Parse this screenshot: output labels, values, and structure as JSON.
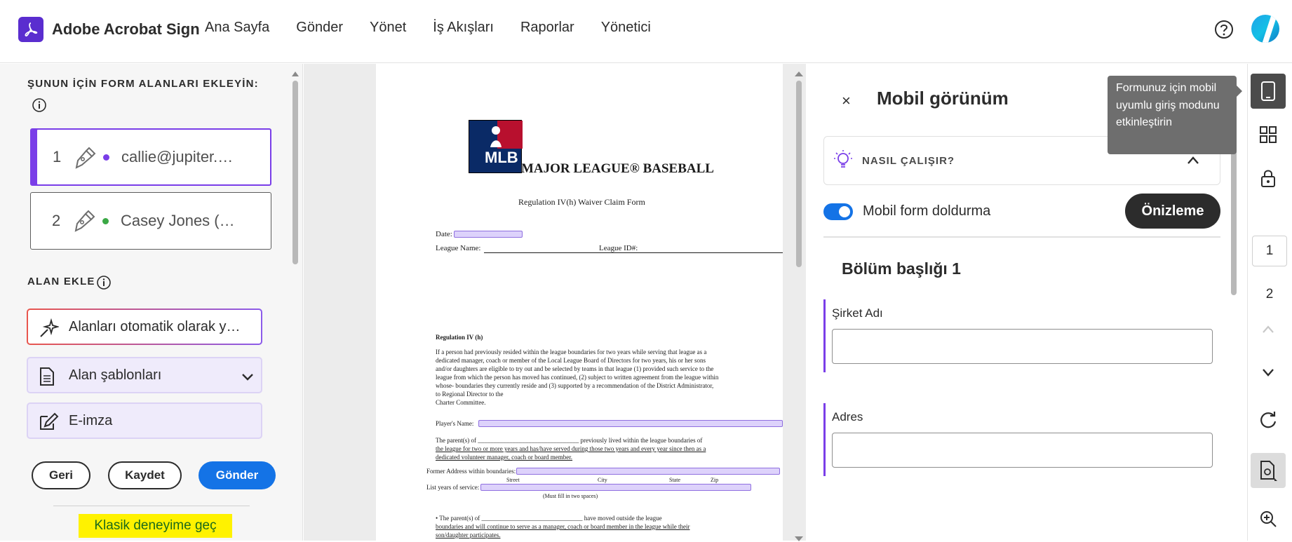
{
  "app": {
    "brand": "Adobe Acrobat Sign"
  },
  "nav": [
    "Ana Sayfa",
    "Gönder",
    "Yönet",
    "İş Akışları",
    "Raporlar",
    "Yönetici"
  ],
  "left": {
    "title": "ŞUNUN İÇİN FORM ALANLARI EKLEYİN:",
    "recipients": [
      {
        "num": "1",
        "email": "callie@jupiter.…",
        "color": "#7a3ee8"
      },
      {
        "num": "2",
        "email": "Casey Jones (…",
        "color": "#3aa845"
      }
    ],
    "add_title": "ALAN EKLE",
    "auto_label": "Alanları otomatik olarak y…",
    "templates_label": "Alan şablonları",
    "esign_label": "E-imza",
    "back_label": "Geri",
    "save_label": "Kaydet",
    "send_label": "Gönder",
    "classic_label": "Klasik deneyime geç"
  },
  "doc": {
    "logo_text": "MLB",
    "title": "MAJOR LEAGUE® BASEBALL",
    "form_title": "Regulation IV(h) Waiver Claim Form",
    "date_label": "Date:",
    "league_name_label": "League Name:",
    "league_id_label": "League ID#:",
    "reg_heading": "Regulation IV (h)",
    "paragraph": [
      "If a person had previously resided within the league boundaries for two years while serving that league as a",
      "dedicated manager, coach or member of the Local League Board of Directors for two years, his or her sons",
      "and/or daughters are eligible to try out and be selected by teams in that league (1) provided such service to the",
      "league from which the person has moved has continued, (2) subject to written agreement from the league within",
      "whose- boundaries they currently reside and (3) supported by a recommendation of the District Administrator,",
      "to Regional Director to the",
      "Charter Committee."
    ],
    "player_name_label": "Player's Name:",
    "parents_line1": "The parent(s) of ________________________________ previously lived within the league boundaries of",
    "parents_line2": "the league for two or more years and has/have served during those two years and every year since then as a",
    "parents_line3": "dedicated volunteer manager, coach or board member.",
    "former_address_label": "Former Address within boundaries:",
    "addr_street": "Street",
    "addr_city": "City",
    "addr_state": "State",
    "addr_zip": "Zip",
    "years_label": "List years of service:",
    "years_note": "(Must fill in two spaces)",
    "moved_line1": "• The parent(s) of ________________________________ have moved outside the league",
    "moved_line2": "boundaries and will continue to serve as a manager, coach or board member in the league while their",
    "moved_line3": "son/daughter participates."
  },
  "mobile": {
    "close": "×",
    "title": "Mobil görünüm",
    "how_label": "NASIL ÇALIŞIR?",
    "toggle_label": "Mobil form doldurma",
    "preview_label": "Önizleme",
    "section_title": "Bölüm başlığı 1",
    "fields": [
      "Şirket Adı",
      "Adres"
    ]
  },
  "tooltip": "Formunuz için mobil uyumlu giriş modunu etkinleştirin",
  "rail": {
    "page_current": "1",
    "page_next": "2"
  },
  "colors": {
    "accent": "#1473e6",
    "purple": "#7a3ee8",
    "highlight": "#fff200"
  }
}
